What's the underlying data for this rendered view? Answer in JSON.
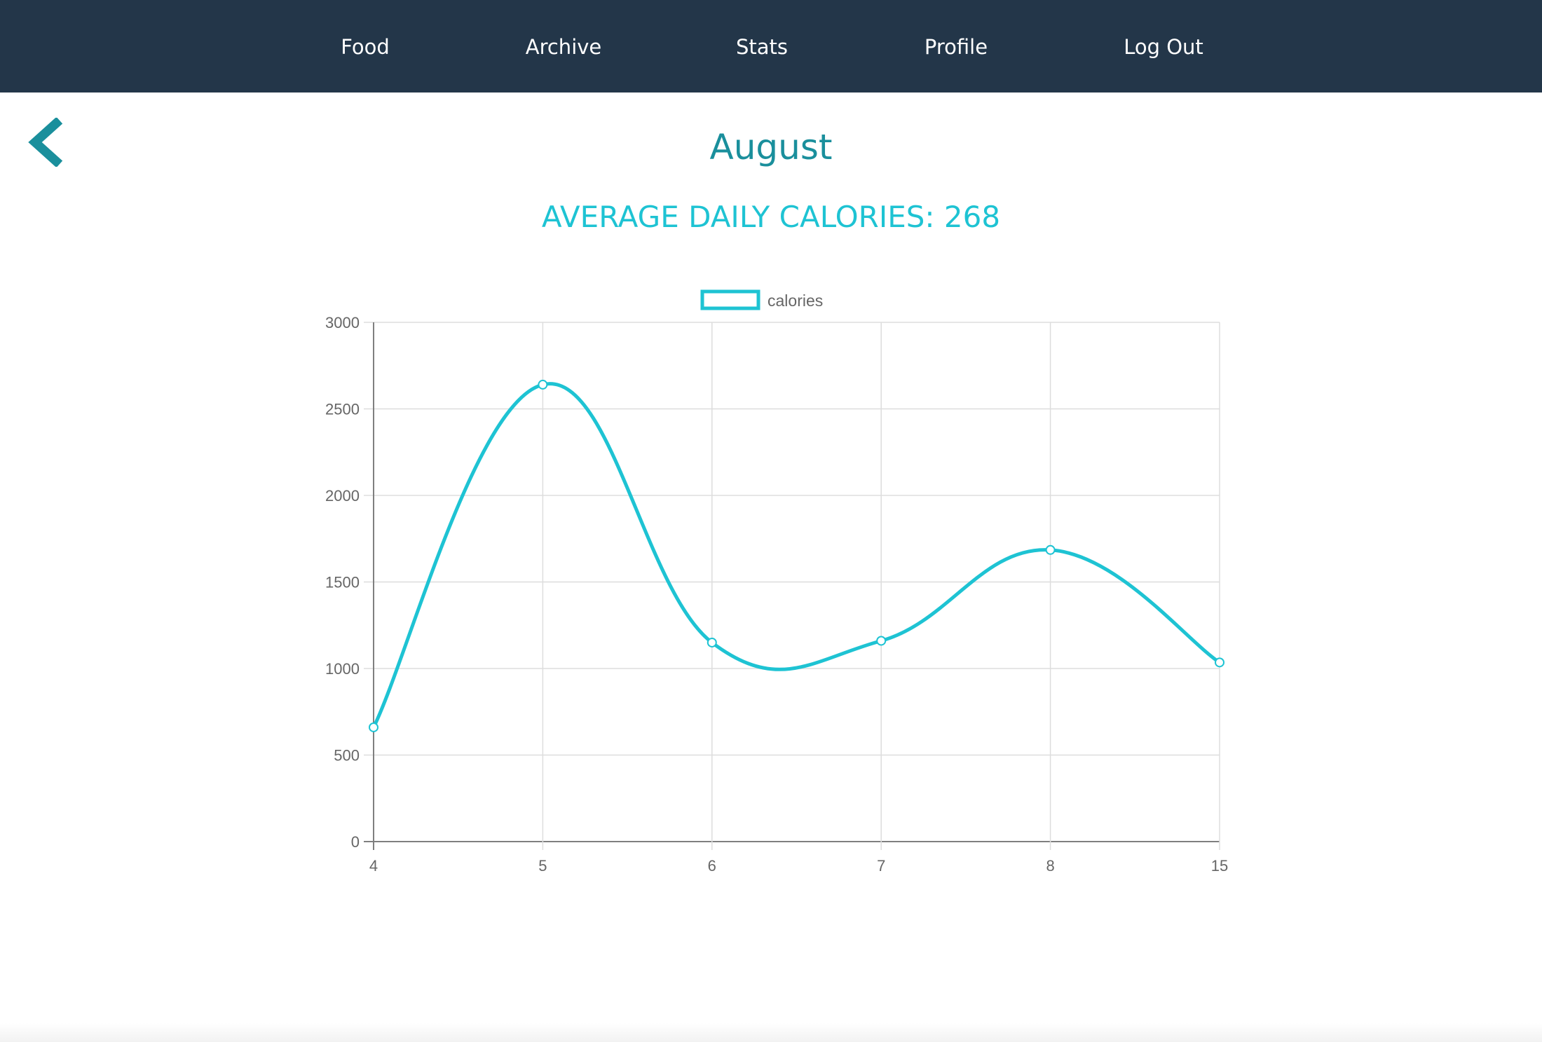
{
  "nav": {
    "items": [
      {
        "label": "Food"
      },
      {
        "label": "Archive"
      },
      {
        "label": "Stats"
      },
      {
        "label": "Profile"
      },
      {
        "label": "Log Out"
      }
    ]
  },
  "header": {
    "title": "August",
    "average_label": "AVERAGE DAILY CALORIES: 268"
  },
  "colors": {
    "navbar": "#233649",
    "title": "#1a8f9c",
    "accent": "#1ec3d3"
  },
  "icons": {
    "back": "chevron-left-icon"
  },
  "chart_data": {
    "type": "line",
    "categories": [
      "4",
      "5",
      "6",
      "7",
      "8",
      "15"
    ],
    "series": [
      {
        "name": "calories",
        "values": [
          660,
          2640,
          1150,
          1160,
          1685,
          1035
        ]
      }
    ],
    "ylim": [
      0,
      3000
    ],
    "yticks": [
      0,
      500,
      1000,
      1500,
      2000,
      2500,
      3000
    ],
    "grid": true,
    "legend": "top-center",
    "smooth": true
  }
}
